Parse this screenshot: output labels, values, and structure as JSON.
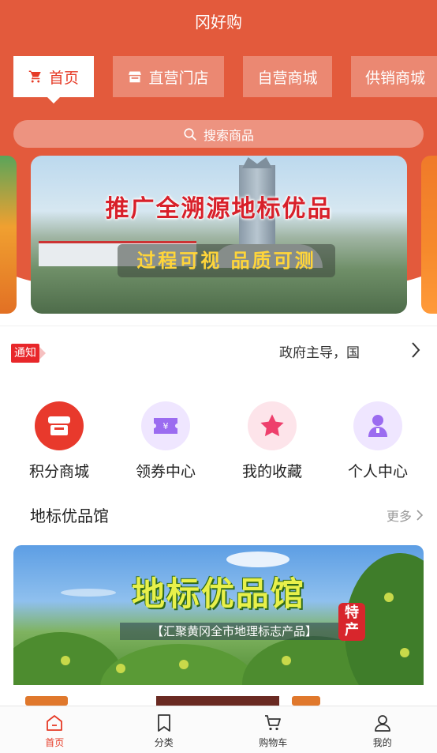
{
  "app": {
    "title": "冈好购"
  },
  "tabs": [
    {
      "label": "首页",
      "icon": "cart-icon",
      "active": true
    },
    {
      "label": "直营门店",
      "icon": "store-icon",
      "active": false
    },
    {
      "label": "自营商城",
      "active": false
    },
    {
      "label": "供销商城",
      "active": false
    }
  ],
  "search": {
    "placeholder": "搜索商品"
  },
  "banner": {
    "title": "推广全溯源地标优品",
    "subtitle": "过程可视 品质可测"
  },
  "notice": {
    "badge": "通知",
    "text": "政府主导，国"
  },
  "quick_entries": [
    {
      "label": "积分商城",
      "icon": "points-mall-icon",
      "color": "#e8392c"
    },
    {
      "label": "领券中心",
      "icon": "coupon-icon",
      "color": "#9b6cf0"
    },
    {
      "label": "我的收藏",
      "icon": "star-icon",
      "color": "#ee3f6c"
    },
    {
      "label": "个人中心",
      "icon": "person-icon",
      "color": "#9b6cf0"
    }
  ],
  "section": {
    "title": "地标优品馆",
    "more": "更多"
  },
  "feature": {
    "title": "地标优品馆",
    "subtitle": "【汇聚黄冈全市地理标志产品】",
    "badge": "特产"
  },
  "bottom_nav": [
    {
      "label": "首页",
      "icon": "home-icon",
      "active": true
    },
    {
      "label": "分类",
      "icon": "bookmark-icon",
      "active": false
    },
    {
      "label": "购物车",
      "icon": "shopping-cart-icon",
      "active": false
    },
    {
      "label": "我的",
      "icon": "user-icon",
      "active": false
    }
  ],
  "colors": {
    "primary": "#e35a3c",
    "accent_red": "#e63a26"
  }
}
